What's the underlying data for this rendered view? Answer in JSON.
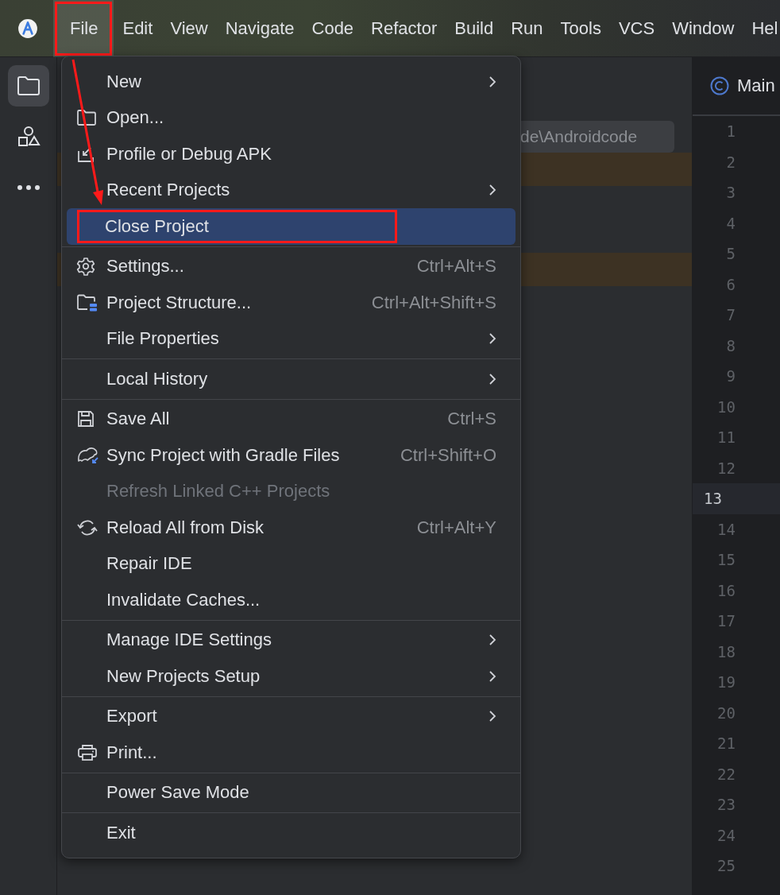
{
  "menubar": {
    "items": [
      {
        "label": "File",
        "selected": true,
        "marked": true
      },
      {
        "label": "Edit",
        "selected": false,
        "marked": false
      },
      {
        "label": "View",
        "selected": false,
        "marked": false
      },
      {
        "label": "Navigate",
        "selected": false,
        "marked": false
      },
      {
        "label": "Code",
        "selected": false,
        "marked": false
      },
      {
        "label": "Refactor",
        "selected": false,
        "marked": false
      },
      {
        "label": "Build",
        "selected": false,
        "marked": false
      },
      {
        "label": "Run",
        "selected": false,
        "marked": false
      },
      {
        "label": "Tools",
        "selected": false,
        "marked": false
      },
      {
        "label": "VCS",
        "selected": false,
        "marked": false
      },
      {
        "label": "Window",
        "selected": false,
        "marked": false
      },
      {
        "label": "Hel",
        "selected": false,
        "marked": false
      }
    ]
  },
  "sidebar": {
    "items": [
      {
        "kind": "project",
        "selected": true
      },
      {
        "kind": "resources",
        "selected": false
      },
      {
        "kind": "more",
        "selected": false
      }
    ]
  },
  "project_panel": {
    "path_field": {
      "value": "de\\Androidcode"
    },
    "tree_rows": [
      {
        "highlighted": true
      },
      {
        "highlighted": false
      },
      {
        "highlighted": false
      },
      {
        "highlighted": true
      }
    ]
  },
  "editor": {
    "tab": {
      "label": "Main"
    },
    "line_numbers": [
      {
        "number": "1",
        "current": false
      },
      {
        "number": "2",
        "current": false
      },
      {
        "number": "3",
        "current": false
      },
      {
        "number": "4",
        "current": false
      },
      {
        "number": "5",
        "current": false
      },
      {
        "number": "6",
        "current": false
      },
      {
        "number": "7",
        "current": false
      },
      {
        "number": "8",
        "current": false
      },
      {
        "number": "9",
        "current": false
      },
      {
        "number": "10",
        "current": false
      },
      {
        "number": "11",
        "current": false
      },
      {
        "number": "12",
        "current": false
      },
      {
        "number": "13",
        "current": true
      },
      {
        "number": "14",
        "current": false
      },
      {
        "number": "15",
        "current": false
      },
      {
        "number": "16",
        "current": false
      },
      {
        "number": "17",
        "current": false
      },
      {
        "number": "18",
        "current": false
      },
      {
        "number": "19",
        "current": false
      },
      {
        "number": "20",
        "current": false
      },
      {
        "number": "21",
        "current": false
      },
      {
        "number": "22",
        "current": false
      },
      {
        "number": "23",
        "current": false
      },
      {
        "number": "24",
        "current": false
      },
      {
        "number": "25",
        "current": false
      }
    ]
  },
  "file_menu": {
    "annotation_arrow": true,
    "groups": [
      [
        {
          "label": "New",
          "kind": "plain",
          "submenu": true,
          "selected": false,
          "disabled": false,
          "marked": false
        },
        {
          "label": "Open...",
          "kind": "open",
          "submenu": false,
          "selected": false,
          "disabled": false,
          "marked": false
        },
        {
          "label": "Profile or Debug APK",
          "kind": "apk",
          "submenu": false,
          "selected": false,
          "disabled": false,
          "marked": false
        },
        {
          "label": "Recent Projects",
          "kind": "plain",
          "submenu": true,
          "selected": false,
          "disabled": false,
          "marked": false
        },
        {
          "label": "Close Project",
          "kind": "plain",
          "submenu": false,
          "selected": true,
          "disabled": false,
          "marked": true
        }
      ],
      [
        {
          "label": "Settings...",
          "kind": "settings",
          "shortcut": "Ctrl+Alt+S",
          "submenu": false,
          "selected": false,
          "disabled": false,
          "marked": false
        },
        {
          "label": "Project Structure...",
          "kind": "structure",
          "shortcut": "Ctrl+Alt+Shift+S",
          "submenu": false,
          "selected": false,
          "disabled": false,
          "marked": false
        },
        {
          "label": "File Properties",
          "kind": "plain",
          "submenu": true,
          "selected": false,
          "disabled": false,
          "marked": false
        }
      ],
      [
        {
          "label": "Local History",
          "kind": "plain",
          "submenu": true,
          "selected": false,
          "disabled": false,
          "marked": false
        }
      ],
      [
        {
          "label": "Save All",
          "kind": "save",
          "shortcut": "Ctrl+S",
          "submenu": false,
          "selected": false,
          "disabled": false,
          "marked": false
        },
        {
          "label": "Sync Project with Gradle Files",
          "kind": "sync",
          "shortcut": "Ctrl+Shift+O",
          "submenu": false,
          "selected": false,
          "disabled": false,
          "marked": false
        },
        {
          "label": "Refresh Linked C++ Projects",
          "kind": "plain",
          "submenu": false,
          "selected": false,
          "disabled": true,
          "marked": false
        },
        {
          "label": "Reload All from Disk",
          "kind": "reload",
          "shortcut": "Ctrl+Alt+Y",
          "submenu": false,
          "selected": false,
          "disabled": false,
          "marked": false
        },
        {
          "label": "Repair IDE",
          "kind": "plain",
          "submenu": false,
          "selected": false,
          "disabled": false,
          "marked": false
        },
        {
          "label": "Invalidate Caches...",
          "kind": "plain",
          "submenu": false,
          "selected": false,
          "disabled": false,
          "marked": false
        }
      ],
      [
        {
          "label": "Manage IDE Settings",
          "kind": "plain",
          "submenu": true,
          "selected": false,
          "disabled": false,
          "marked": false
        },
        {
          "label": "New Projects Setup",
          "kind": "plain",
          "submenu": true,
          "selected": false,
          "disabled": false,
          "marked": false
        }
      ],
      [
        {
          "label": "Export",
          "kind": "plain",
          "submenu": true,
          "selected": false,
          "disabled": false,
          "marked": false
        },
        {
          "label": "Print...",
          "kind": "print",
          "submenu": false,
          "selected": false,
          "disabled": false,
          "marked": false
        }
      ],
      [
        {
          "label": "Power Save Mode",
          "kind": "plain",
          "submenu": false,
          "selected": false,
          "disabled": false,
          "marked": false
        }
      ],
      [
        {
          "label": "Exit",
          "kind": "plain",
          "submenu": false,
          "selected": false,
          "disabled": false,
          "marked": false
        }
      ]
    ]
  }
}
